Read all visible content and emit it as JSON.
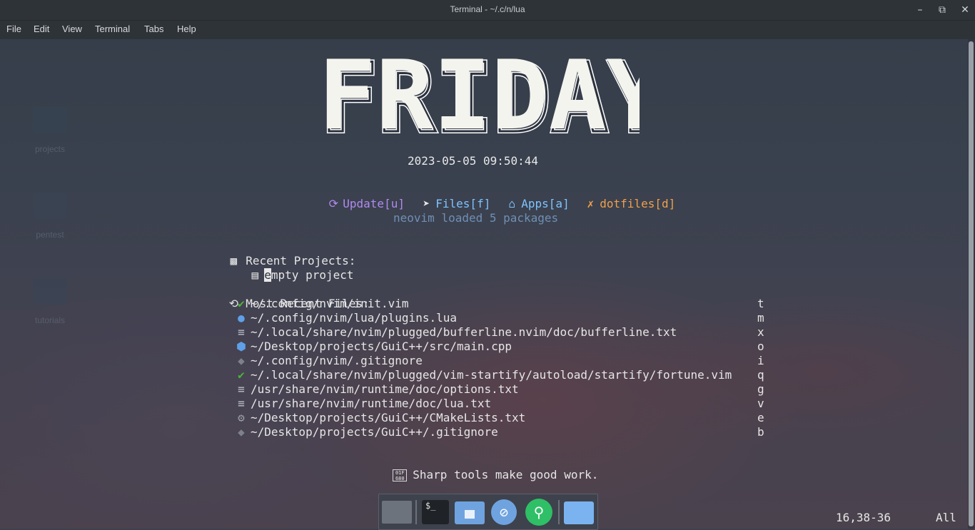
{
  "window": {
    "title": "Terminal - ~/.c/n/lua",
    "controls": [
      "minimize",
      "maximize",
      "close"
    ]
  },
  "menu": [
    "File",
    "Edit",
    "View",
    "Terminal",
    "Tabs",
    "Help"
  ],
  "desktop_icons": [
    "projects",
    "pentest",
    "tutorials"
  ],
  "banner": {
    "text": "FRIDAY"
  },
  "datetime": "2023-05-05 09:50:44",
  "actions": [
    {
      "icon": "update-icon",
      "label": "Update[u]",
      "color": "#b18af0"
    },
    {
      "icon": "telegram-icon",
      "label": "Files[f]",
      "color": "#7fc3ff"
    },
    {
      "icon": "home-icon",
      "label": "Apps[a]",
      "color": "#7fc3ff"
    },
    {
      "icon": "tools-icon",
      "label": "dotfiles[d]",
      "color": "#f0a04b"
    }
  ],
  "packages_line": "neovim loaded 5 packages",
  "recent_projects": {
    "header": "Recent Projects:",
    "items": [
      {
        "text": "empty project"
      }
    ]
  },
  "recent_files": {
    "header": "Most Recent Files:",
    "items": [
      {
        "icon": "vim-icon",
        "path": "~/.config/nvim/init.vim",
        "key": "t",
        "color": "#4fb33d"
      },
      {
        "icon": "lua-icon",
        "path": "~/.config/nvim/lua/plugins.lua",
        "key": "m",
        "color": "#5fa0e8"
      },
      {
        "icon": "file-icon",
        "path": "~/.local/share/nvim/plugged/bufferline.nvim/doc/bufferline.txt",
        "key": "x",
        "color": "#b9c0c8"
      },
      {
        "icon": "cpp-icon",
        "path": "~/Desktop/projects/GuiC++/src/main.cpp",
        "key": "o",
        "color": "#5fa0e8"
      },
      {
        "icon": "git-icon",
        "path": "~/.config/nvim/.gitignore",
        "key": "i",
        "color": "#7c818a"
      },
      {
        "icon": "vim-icon",
        "path": "~/.local/share/nvim/plugged/vim-startify/autoload/startify/fortune.vim",
        "key": "q",
        "color": "#4fb33d"
      },
      {
        "icon": "file-icon",
        "path": "/usr/share/nvim/runtime/doc/options.txt",
        "key": "g",
        "color": "#b9c0c8"
      },
      {
        "icon": "file-icon",
        "path": "/usr/share/nvim/runtime/doc/lua.txt",
        "key": "v",
        "color": "#b9c0c8"
      },
      {
        "icon": "gear-icon",
        "path": "~/Desktop/projects/GuiC++/CMakeLists.txt",
        "key": "e",
        "color": "#9aa0a8"
      },
      {
        "icon": "git-icon",
        "path": "~/Desktop/projects/GuiC++/.gitignore",
        "key": "b",
        "color": "#7c818a"
      }
    ]
  },
  "footer_quote": "Sharp tools make good work.",
  "footer_glyph": "01F 680",
  "status": {
    "position": "16,38-36",
    "scroll": "All"
  },
  "dock": [
    "show-desktop",
    "terminal",
    "home-folder",
    "browser",
    "search",
    "file-manager"
  ]
}
